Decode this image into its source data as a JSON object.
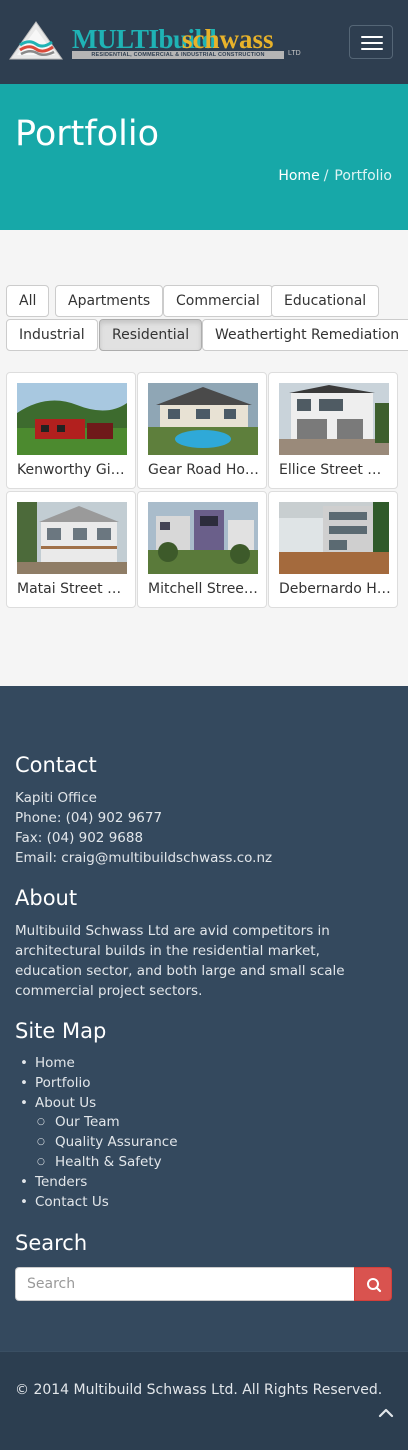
{
  "brand": {
    "name_part1": "MULTIbuild",
    "name_part2": "schwass",
    "tagline": "RESIDENTIAL, COMMERCIAL & INDUSTRIAL CONSTRUCTION",
    "suffix": "LTD",
    "colors": {
      "teal": "#1fb3b5",
      "gold": "#e8b22a"
    }
  },
  "page": {
    "title": "Portfolio",
    "breadcrumb": {
      "home": "Home",
      "separator": "/",
      "current": "Portfolio"
    }
  },
  "filters": [
    {
      "label": "All",
      "active": false
    },
    {
      "label": "Apartments",
      "active": false
    },
    {
      "label": "Commercial",
      "active": false
    },
    {
      "label": "Educational",
      "active": false
    },
    {
      "label": "Industrial",
      "active": false
    },
    {
      "label": "Residential",
      "active": true
    },
    {
      "label": "Weathertight Remediation",
      "active": false
    }
  ],
  "projects": [
    {
      "title": "Kenworthy Gibbons House",
      "icon": "house-photo"
    },
    {
      "title": "Gear Road House",
      "icon": "house-photo"
    },
    {
      "title": "Ellice Street House",
      "icon": "house-photo"
    },
    {
      "title": "Matai Street House",
      "icon": "house-photo"
    },
    {
      "title": "Mitchell Street House",
      "icon": "house-photo"
    },
    {
      "title": "Debernardo House",
      "icon": "house-photo"
    }
  ],
  "footer": {
    "contact": {
      "heading": "Contact",
      "office": "Kapiti Office",
      "phone": "Phone: (04) 902 9677",
      "fax": "Fax: (04) 902 9688",
      "email": "Email: craig@multibuildschwass.co.nz"
    },
    "about": {
      "heading": "About",
      "text": "Multibuild Schwass Ltd are avid competitors in architectural builds in the residential market, education sector, and both large and small scale commercial project sectors."
    },
    "sitemap": {
      "heading": "Site Map",
      "home": "Home",
      "portfolio": "Portfolio",
      "about_us": "About Us",
      "our_team": "Our Team",
      "quality_assurance": "Quality Assurance",
      "health_safety": "Health & Safety",
      "tenders": "Tenders",
      "contact_us": "Contact Us"
    },
    "search": {
      "heading": "Search",
      "placeholder": "Search"
    },
    "copyright": "© 2014 Multibuild Schwass Ltd. All Rights Reserved."
  },
  "colors": {
    "header_bg": "#2e3e50",
    "title_band": "#17a8a8",
    "footer_bg": "#34495e",
    "search_button": "#d9534f"
  }
}
